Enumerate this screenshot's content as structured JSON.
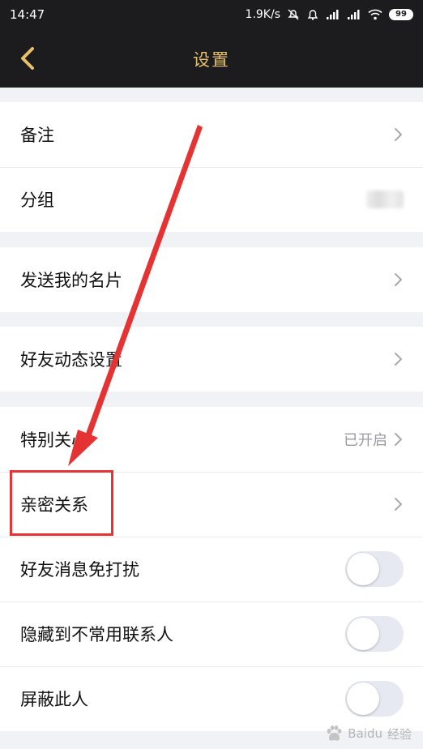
{
  "status_bar": {
    "time": "14:47",
    "network_speed": "1.9K/s",
    "battery": "99",
    "icons": [
      "mute-icon",
      "alarm-icon",
      "signal-icon",
      "signal-icon",
      "wifi-icon",
      "battery-icon"
    ]
  },
  "header": {
    "title": "设置",
    "back_icon": "back-chevron-icon",
    "background_color": "#1c1c1e",
    "accent_color": "#e6c06a"
  },
  "groups": [
    {
      "rows": [
        {
          "label": "备注",
          "trailing": "chevron"
        },
        {
          "label": "分组",
          "trailing": "blurred-value"
        }
      ]
    },
    {
      "rows": [
        {
          "label": "发送我的名片",
          "trailing": "chevron"
        }
      ]
    },
    {
      "rows": [
        {
          "label": "好友动态设置",
          "trailing": "chevron"
        }
      ]
    },
    {
      "rows": [
        {
          "label": "特别关心",
          "value": "已开启",
          "trailing": "chevron"
        },
        {
          "label": "亲密关系",
          "trailing": "chevron",
          "highlighted": true
        },
        {
          "label": "好友消息免打扰",
          "trailing": "toggle",
          "toggle_on": false
        },
        {
          "label": "隐藏到不常用联系人",
          "trailing": "toggle",
          "toggle_on": false
        },
        {
          "label": "屏蔽此人",
          "trailing": "toggle",
          "toggle_on": false
        }
      ]
    }
  ],
  "annotation": {
    "arrow_color": "#e53333",
    "highlight_color": "#e53333"
  },
  "watermark": {
    "logo": "Baidu",
    "text": "经验"
  }
}
